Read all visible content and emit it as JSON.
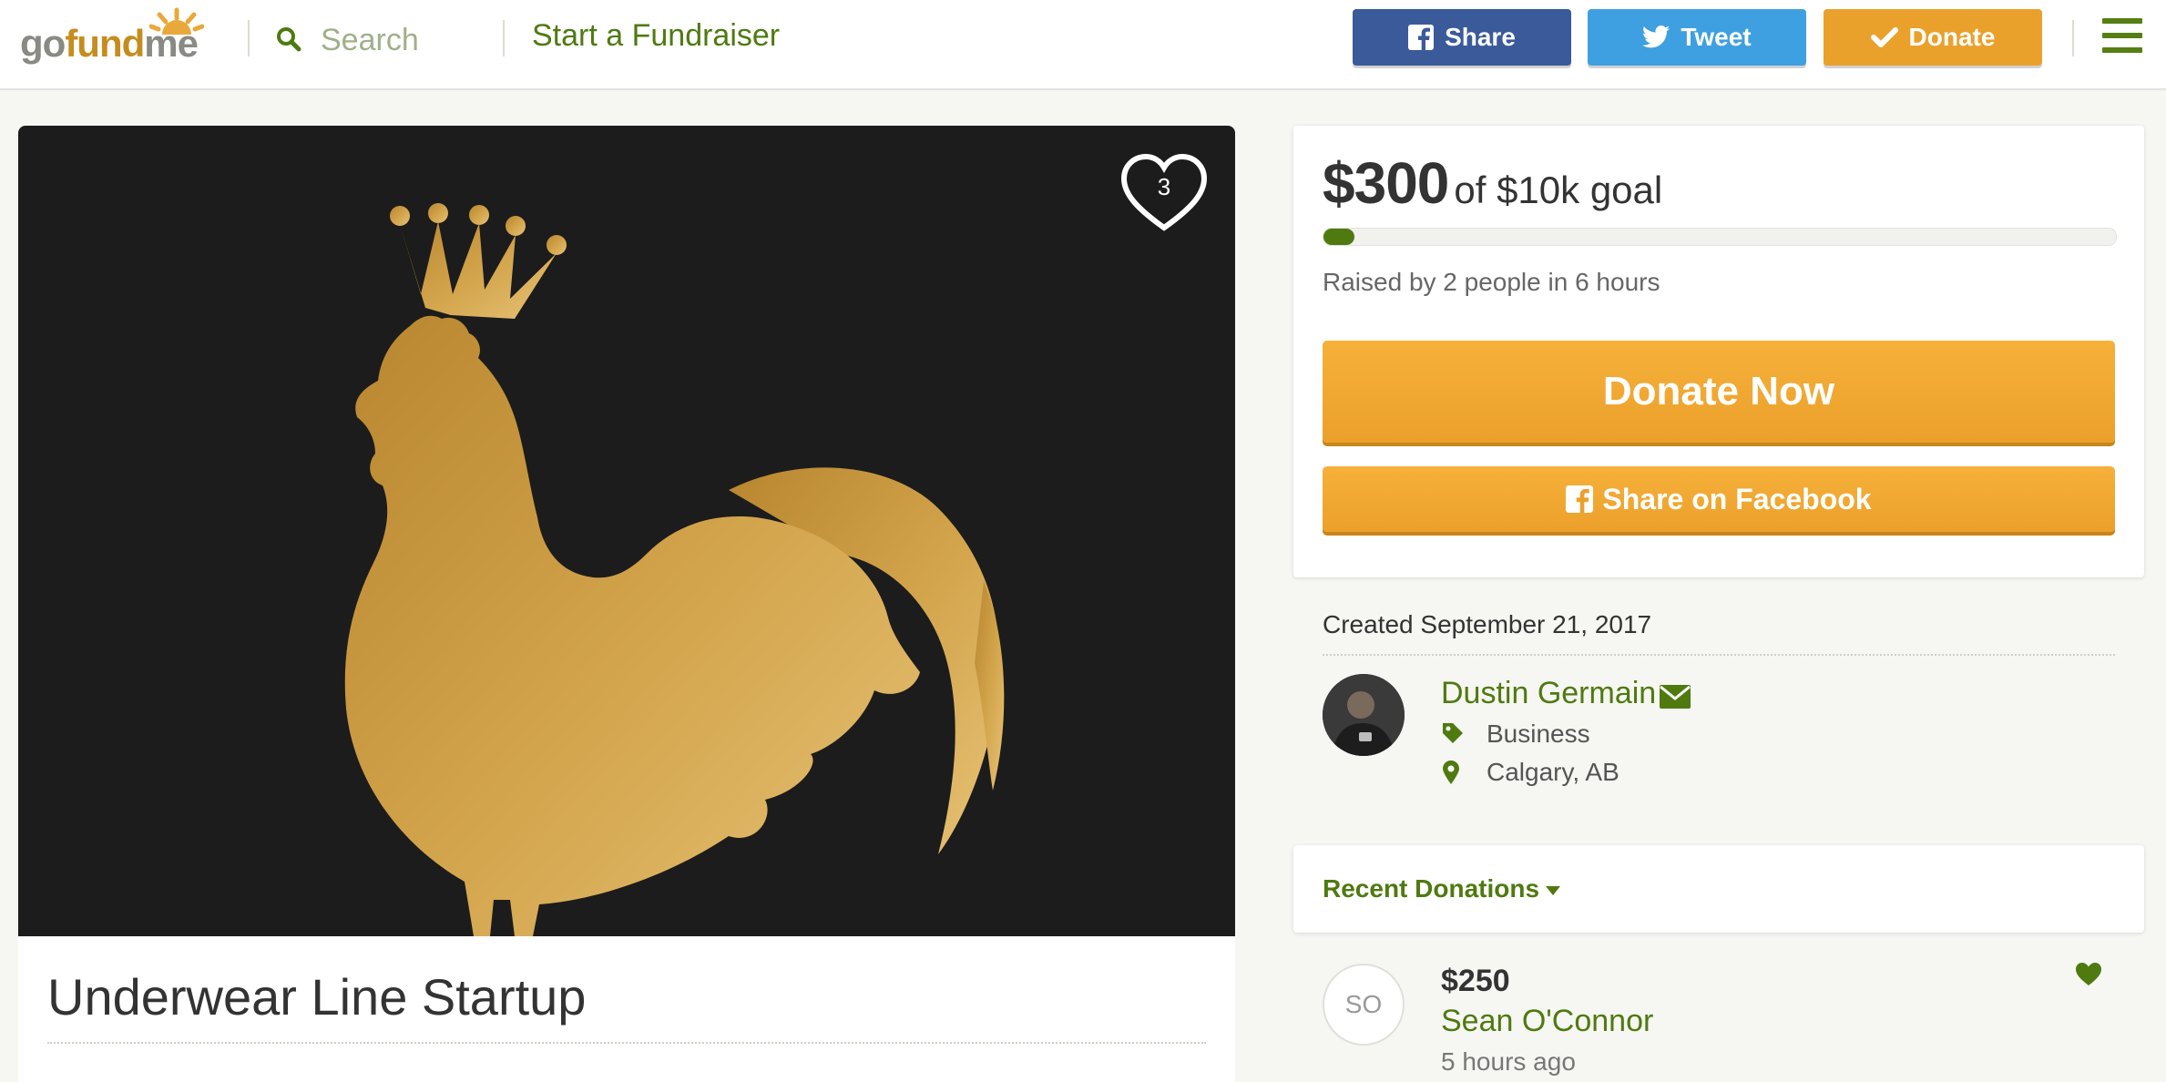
{
  "header": {
    "logo": {
      "go": "go",
      "fund": "fund",
      "me": "me"
    },
    "search_placeholder": "Search",
    "start_fundraiser": "Start a Fundraiser",
    "share_label": "Share",
    "tweet_label": "Tweet",
    "donate_label": "Donate"
  },
  "campaign": {
    "title": "Underwear Line Startup",
    "favorites_count": "3",
    "image_subject": "gold-rooster-with-crown"
  },
  "goal": {
    "raised": "$300",
    "goal_text": "of $10k goal",
    "progress_fraction": 0.03,
    "raised_by": "Raised by 2 people in 6 hours",
    "donate_now": "Donate Now",
    "share_facebook": "Share on Facebook"
  },
  "organizer": {
    "created": "Created September 21, 2017",
    "name": "Dustin Germain",
    "category": "Business",
    "location": "Calgary, AB"
  },
  "donations": {
    "title": "Recent Donations",
    "items": [
      {
        "initials": "SO",
        "amount": "$250",
        "name": "Sean O'Connor",
        "time": "5 hours ago"
      }
    ]
  },
  "colors": {
    "brand_green": "#4f7a10",
    "orange": "#eba02b",
    "facebook_blue": "#3b5a9a",
    "twitter_blue": "#3ea0e0",
    "gold": "#c9a04a"
  },
  "icons": [
    "search-icon",
    "facebook-icon",
    "twitter-icon",
    "check-icon",
    "hamburger-icon",
    "heart-icon",
    "mail-icon",
    "tag-icon",
    "map-marker-icon",
    "caret-down-icon"
  ]
}
